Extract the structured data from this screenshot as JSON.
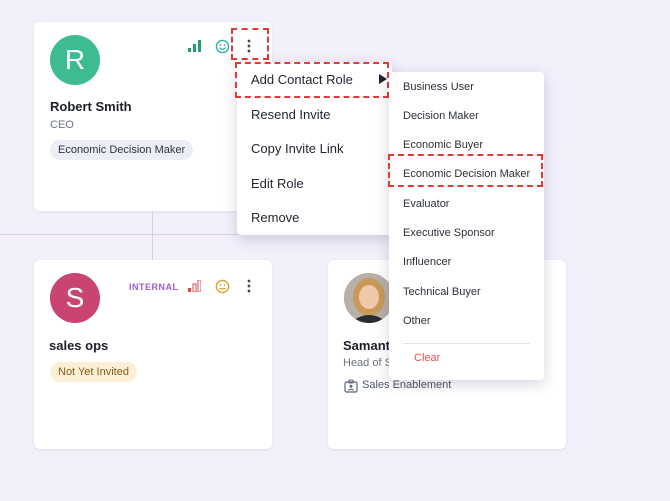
{
  "cards": {
    "robert": {
      "initial": "R",
      "name": "Robert Smith",
      "title": "CEO",
      "role_chip": "Economic Decision Maker"
    },
    "sales_ops": {
      "initial": "S",
      "name": "sales ops",
      "badge": "INTERNAL",
      "status_chip": "Not Yet Invited"
    },
    "samantha": {
      "name": "Samant",
      "title": "Head of S",
      "department": "Sales Enablement"
    }
  },
  "context_menu": {
    "items": [
      "Add Contact Role",
      "Resend Invite",
      "Copy Invite Link",
      "Edit Role",
      "Remove"
    ]
  },
  "role_submenu": {
    "items": [
      "Business User",
      "Decision Maker",
      "Economic Buyer",
      "Economic Decision Maker",
      "Evaluator",
      "Executive Sponsor",
      "Influencer",
      "Technical Buyer",
      "Other"
    ],
    "clear_label": "Clear"
  },
  "colors": {
    "avatar_r": "#3dbd8f",
    "avatar_s": "#c9446f",
    "signal_green": "#22a06b",
    "signal_red": "#e04848",
    "smile_teal": "#2bb3a0",
    "neutral_orange": "#e0a030",
    "highlight_red": "#e53935",
    "internal_purple": "#a25bd6",
    "clear_red": "#e05050"
  },
  "icons": [
    "signal-bars-icon",
    "smile-face-icon",
    "neutral-face-icon",
    "kebab-menu-icon",
    "submenu-arrow-icon",
    "id-badge-icon"
  ]
}
